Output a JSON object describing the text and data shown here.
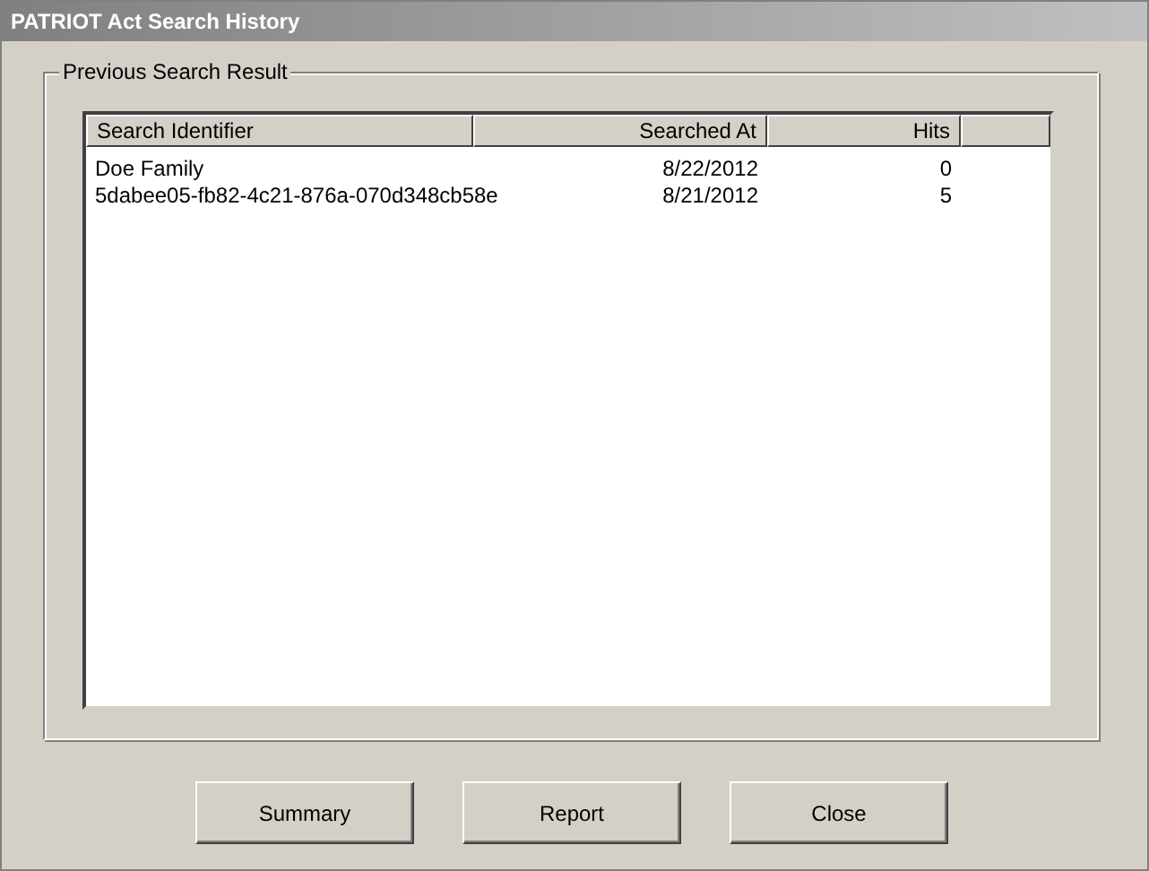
{
  "window": {
    "title": "PATRIOT Act Search History"
  },
  "group": {
    "label": "Previous Search Result"
  },
  "table": {
    "columns": [
      "Search Identifier",
      "Searched At",
      "Hits"
    ],
    "rows": [
      [
        "Doe Family",
        "8/22/2012",
        "0"
      ],
      [
        "5dabee05-fb82-4c21-876a-070d348cb58e",
        "8/21/2012",
        "5"
      ]
    ]
  },
  "buttons": [
    "Summary",
    "Report",
    "Close"
  ]
}
